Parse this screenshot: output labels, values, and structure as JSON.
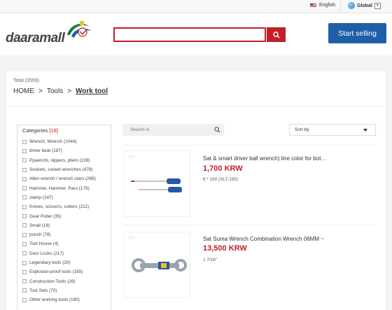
{
  "topbar": {
    "language": "English",
    "region": "Global"
  },
  "header": {
    "logo": "daaramall",
    "search": {
      "value": "",
      "placeholder": ""
    },
    "start_selling": "Start selling"
  },
  "summary": {
    "total": "Total (3559)"
  },
  "breadcrumb": {
    "items": [
      "HOME",
      ">",
      "Tools",
      ">"
    ],
    "current": "Work tool"
  },
  "categories": {
    "title": "Categories",
    "count": "[18]",
    "items": [
      "Wrench, Wrench (1044)",
      "driver beat (187)",
      "Ppaenchi, nippers, pliers (228)",
      "Sockets, socket wrenches (478)",
      "Allen wrench / wrench stars (269)",
      "Hammer, Hammer, Paru (179)",
      "clamp (147)",
      "Knives, scissors, cutters (212)",
      "Gear Puller (35)",
      "Small (18)",
      "punch (78)",
      "Tool House (4)",
      "Door Locks (217)",
      "Legendary tools (20)",
      "Explosion-proof tools (165)",
      "Construction Tools (28)",
      "Tool Sets (70)",
      "Other working tools (180)"
    ]
  },
  "search_in": {
    "placeholder": "Search in"
  },
  "sort": {
    "label": "Sort by"
  },
  "products": [
    {
      "title": "Sat & smart driver ball wrench) line color for bot…",
      "price": "1,700 KRW",
      "model": "6 * 150 (SLT-150)"
    },
    {
      "title": "Sat Suma Wrench Combination Wrench 06MM ~",
      "price": "13,500 KRW",
      "model": "1 7/16\""
    }
  ],
  "colors": {
    "accent": "#c0202a",
    "primary": "#1f5fa8"
  }
}
